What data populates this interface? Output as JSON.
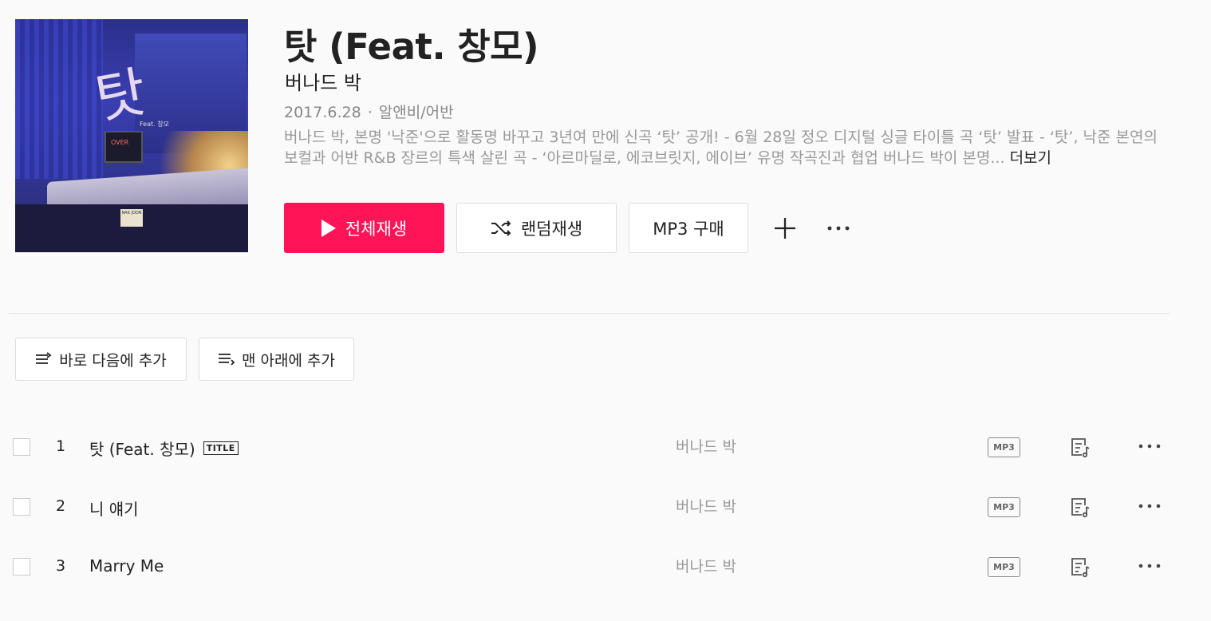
{
  "album": {
    "title": "탓 (Feat. 창모)",
    "artist": "버나드 박",
    "date": "2017.6.28",
    "genre": "알앤비/어반",
    "description": "버나드 박, 본명 '낙준'으로 활동명 바꾸고 3년여 만에 신곡 ‘탓’ 공개! - 6월 28일 정오 디지털 싱글 타이틀 곡 ‘탓’ 발표 - ‘탓’, 낙준 본연의 보컬과 어반 R&B 장르의 특색 살린 곡 - ‘아르마딜로, 에코브릿지, 에이브’ 유명 작곡진과 협업 버나드 박이 본명...",
    "more_label": "더보기"
  },
  "cover": {
    "script": "탓",
    "feat": "Feat. 창모",
    "tv": "OVER",
    "badge": "NAK JOON"
  },
  "actions": {
    "play_all": "전체재생",
    "shuffle": "랜덤재생",
    "buy_mp3": "MP3 구매"
  },
  "queue": {
    "add_next": "바로 다음에 추가",
    "add_bottom": "맨 아래에 추가"
  },
  "tracks": [
    {
      "num": "1",
      "title": "탓 (Feat. 창모)",
      "tag": "TITLE",
      "artist": "버나드 박",
      "format": "MP3"
    },
    {
      "num": "2",
      "title": "니 얘기",
      "tag": "",
      "artist": "버나드 박",
      "format": "MP3"
    },
    {
      "num": "3",
      "title": "Marry Me",
      "tag": "",
      "artist": "버나드 박",
      "format": "MP3"
    }
  ],
  "colors": {
    "accent": "#ff1557",
    "muted": "#999999",
    "border": "#dddddd"
  },
  "icons": [
    "play-icon",
    "shuffle-icon",
    "plus-icon",
    "more-icon",
    "queue-next-icon",
    "queue-bottom-icon",
    "lyrics-icon"
  ]
}
